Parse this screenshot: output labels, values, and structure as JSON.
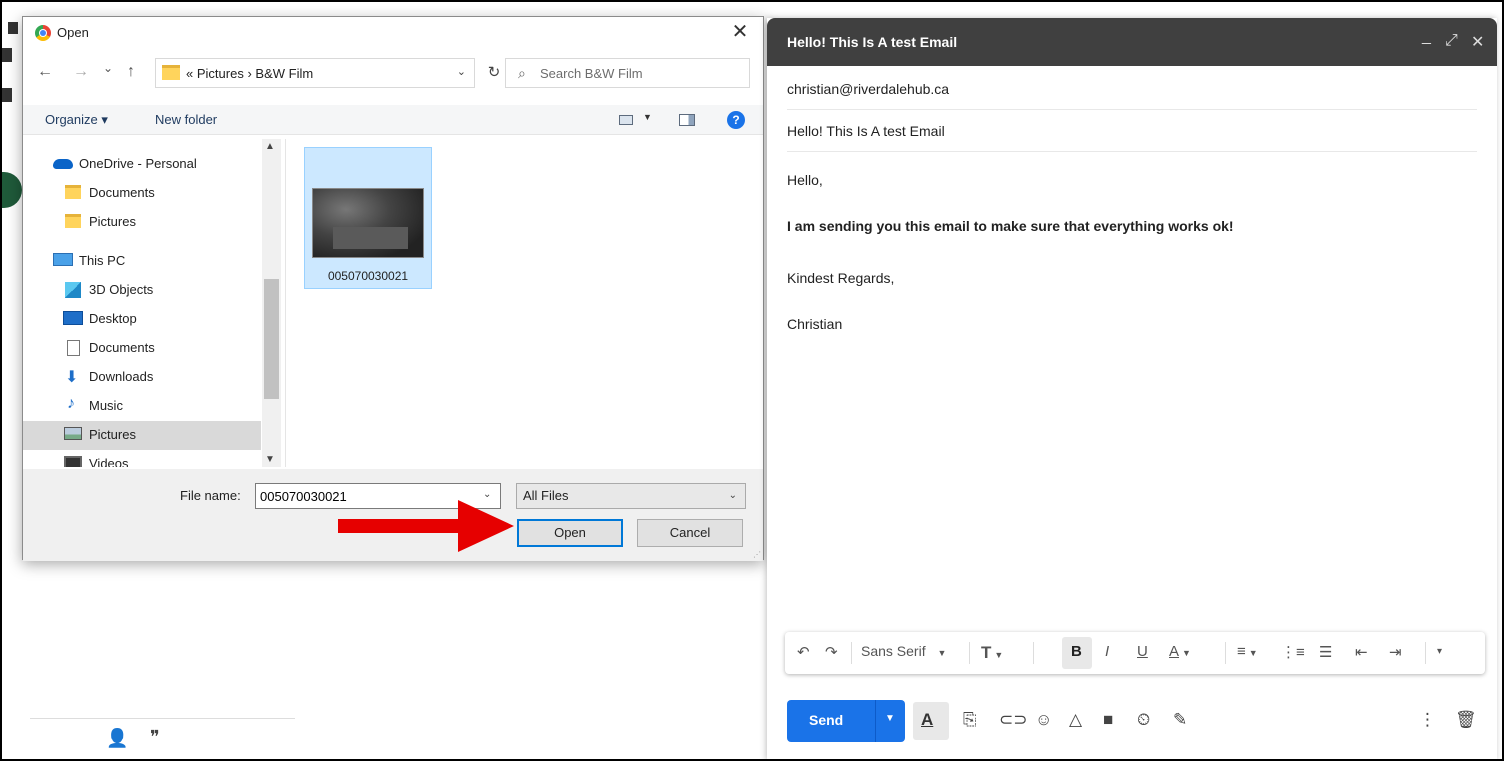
{
  "dialog": {
    "title": "Open",
    "close_glyph": "✕",
    "nav": {
      "back": "←",
      "forward": "→",
      "recent": "⌄",
      "up": "↑"
    },
    "address": {
      "prefix": "«",
      "path": [
        "Pictures",
        "B&W Film"
      ],
      "separator": "›"
    },
    "refresh_glyph": "↻",
    "search_placeholder": "Search B&W Film",
    "toolbar": {
      "organize": "Organize ▾",
      "new_folder": "New folder",
      "help": "?"
    },
    "tree": [
      {
        "label": "OneDrive - Personal",
        "icon": "cloud-icon"
      },
      {
        "label": "Documents",
        "icon": "folder-icon"
      },
      {
        "label": "Pictures",
        "icon": "folder-icon"
      },
      {
        "label": "This PC",
        "icon": "computer-icon"
      },
      {
        "label": "3D Objects",
        "icon": "cube-icon"
      },
      {
        "label": "Desktop",
        "icon": "desktop-icon"
      },
      {
        "label": "Documents",
        "icon": "document-icon"
      },
      {
        "label": "Downloads",
        "icon": "download-icon"
      },
      {
        "label": "Music",
        "icon": "music-icon"
      },
      {
        "label": "Pictures",
        "icon": "picture-icon",
        "selected": true
      },
      {
        "label": "Videos",
        "icon": "video-icon"
      }
    ],
    "files": [
      {
        "name": "005070030021",
        "selected": true
      }
    ],
    "file_name_label": "File name:",
    "file_name_value": "005070030021",
    "filter": "All Files",
    "open_label": "Open",
    "cancel_label": "Cancel"
  },
  "compose": {
    "title": "Hello! This Is A test Email",
    "header_controls": {
      "minimize": "_",
      "expand": "⤢",
      "close": "✕"
    },
    "to": "christian@riverdalehub.ca",
    "subject": "Hello! This Is A test Email",
    "body": {
      "greeting": "Hello,",
      "message": "I am sending you this email to make sure that everything works ok!",
      "closing": "Kindest Regards,",
      "signature": "Christian"
    },
    "formatting": {
      "font": "Sans Serif",
      "undo": "↶",
      "redo": "↷",
      "size": "T",
      "bold": "B",
      "italic": "I",
      "underline": "U",
      "text_color": "A",
      "align": "≡",
      "numbered": "⋮≡",
      "bulleted": "☰",
      "indent_less": "⇤",
      "indent_more": "⇥",
      "more": "▾"
    },
    "send_label": "Send",
    "bottom_icons": [
      "format-text-icon",
      "attach-icon",
      "link-icon",
      "emoji-icon",
      "drive-icon",
      "photo-icon",
      "confidential-icon",
      "signature-icon",
      "more-options-icon",
      "trash-icon"
    ]
  },
  "colors": {
    "accent_blue": "#1a73e8",
    "header_dark": "#404040",
    "arrow_red": "#e60000",
    "selection": "#cce8ff"
  }
}
